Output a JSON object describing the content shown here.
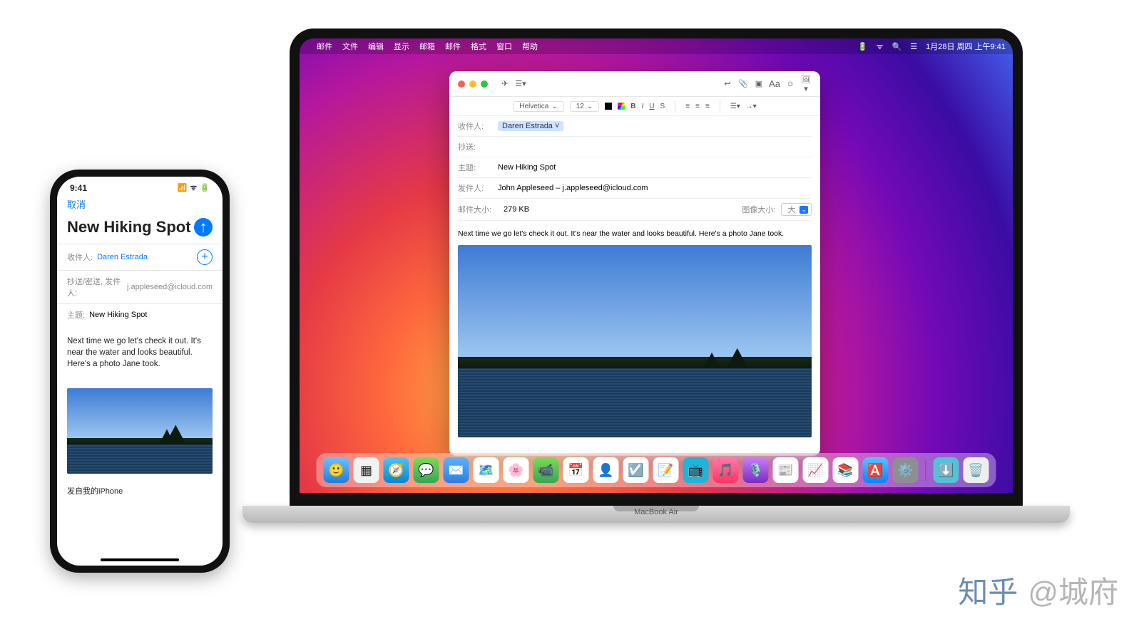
{
  "mac": {
    "menubar": {
      "items": [
        "邮件",
        "文件",
        "编辑",
        "显示",
        "邮箱",
        "邮件",
        "格式",
        "窗口",
        "帮助"
      ],
      "datetime": "1月28日 周四 上午9:41"
    },
    "mail": {
      "format_bar": {
        "font": "Helvetica",
        "size": "12"
      },
      "to_label": "收件人:",
      "to_value": "Daren Estrada",
      "cc_label": "抄送:",
      "subject_label": "主题:",
      "subject_value": "New Hiking Spot",
      "from_label": "发件人:",
      "from_value": "John Appleseed – j.appleseed@icloud.com",
      "size_label": "邮件大小:",
      "size_value": "279 KB",
      "image_size_label": "图像大小:",
      "image_size_value": "大",
      "body": "Next time we go let's check it out. It's near the water and looks beautiful. Here's a photo Jane took."
    },
    "model_label": "MacBook Air"
  },
  "iphone": {
    "status_time": "9:41",
    "cancel": "取消",
    "title": "New Hiking Spot",
    "to_label": "收件人:",
    "to_value": "Daren Estrada",
    "cc_from_label": "抄送/密送, 发件人:",
    "cc_from_value": "j.appleseed@icloud.com",
    "subject_label": "主题:",
    "subject_value": "New Hiking Spot",
    "body": "Next time we go let's check it out. It's near the water and looks beautiful. Here's a photo Jane took.",
    "signature": "发自我的iPhone"
  },
  "watermark": {
    "zhihu": "知乎",
    "author": "@城府"
  }
}
